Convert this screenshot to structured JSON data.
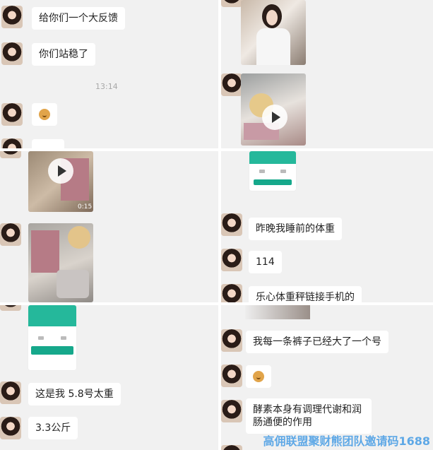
{
  "messages": {
    "m1": "给你们一个大反馈",
    "m2": "你们站稳了",
    "time": "13:14",
    "m3": "这是我 5.8号太重",
    "m4": "3.3公斤",
    "m5": "昨晚我睡前的体重",
    "m6": "114",
    "m7": "乐心体重秤链接手机的",
    "m8": "我每一条裤子已经大了一个号",
    "m9": "酵素本身有调理代谢和润肠通便的作用"
  },
  "video": {
    "duration": "0:15"
  },
  "watermark": "高佣联盟聚财熊团队邀请码1688",
  "colors": {
    "scale_app_green": "#25b89b",
    "watermark_blue": "#5ea8e6"
  }
}
